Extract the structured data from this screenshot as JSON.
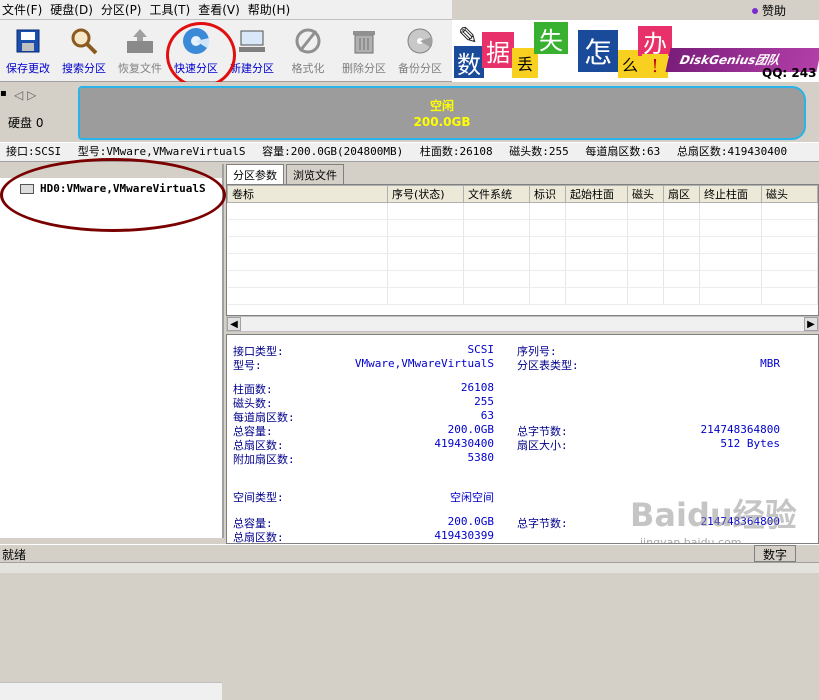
{
  "menu": [
    "文件(F)",
    "硬盘(D)",
    "分区(P)",
    "工具(T)",
    "查看(V)",
    "帮助(H)"
  ],
  "sponsor": "赞助",
  "toolbar": [
    {
      "label": "保存更改",
      "icon": "save-icon",
      "enabled": true
    },
    {
      "label": "搜索分区",
      "icon": "search-icon",
      "enabled": true
    },
    {
      "label": "恢复文件",
      "icon": "recover-icon",
      "enabled": false
    },
    {
      "label": "快速分区",
      "icon": "quick-partition-icon",
      "enabled": true
    },
    {
      "label": "新建分区",
      "icon": "new-partition-icon",
      "enabled": true
    },
    {
      "label": "格式化",
      "icon": "format-icon",
      "enabled": false
    },
    {
      "label": "删除分区",
      "icon": "delete-icon",
      "enabled": false
    },
    {
      "label": "备份分区",
      "icon": "backup-icon",
      "enabled": false
    }
  ],
  "banner": {
    "chars": [
      "数",
      "据",
      "丢",
      "失",
      "怎",
      "么",
      "办",
      "!"
    ],
    "brand": "DiskGenius团队",
    "qq": "QQ: 243"
  },
  "disk": {
    "label": "硬盘 0",
    "free_label": "空闲",
    "free_size": "200.0GB"
  },
  "info": {
    "interface": "接口:SCSI",
    "model": "型号:VMware,VMwareVirtualS",
    "capacity": "容量:200.0GB(204800MB)",
    "cylinders": "柱面数:26108",
    "heads": "磁头数:255",
    "sectors_per_track": "每道扇区数:63",
    "total_sectors": "总扇区数:419430400"
  },
  "tree": {
    "item": "HD0:VMware,VMwareVirtualS"
  },
  "tabs": [
    "分区参数",
    "浏览文件"
  ],
  "table": {
    "headers": [
      "卷标",
      "序号(状态)",
      "文件系统",
      "标识",
      "起始柱面",
      "磁头",
      "扇区",
      "终止柱面",
      "磁头"
    ]
  },
  "details": {
    "interface_type_label": "接口类型:",
    "interface_type": "SCSI",
    "model_label": "型号:",
    "model": "VMware,VMwareVirtualS",
    "serial_label": "序列号:",
    "pt_type_label": "分区表类型:",
    "pt_type": "MBR",
    "cylinders_label": "柱面数:",
    "cylinders": "26108",
    "heads_label": "磁头数:",
    "heads": "255",
    "spt_label": "每道扇区数:",
    "spt": "63",
    "capacity_label": "总容量:",
    "capacity": "200.0GB",
    "total_bytes_label": "总字节数:",
    "total_bytes": "214748364800",
    "total_sectors_label": "总扇区数:",
    "total_sectors": "419430400",
    "sector_size_label": "扇区大小:",
    "sector_size": "512 Bytes",
    "extra_sectors_label": "附加扇区数:",
    "extra_sectors": "5380",
    "space_type_label": "空间类型:",
    "space_type": "空闲空间",
    "free_capacity_label": "总容量:",
    "free_capacity": "200.0GB",
    "free_bytes_label": "总字节数:",
    "free_bytes": "214748364800",
    "free_sectors_label": "总扇区数:",
    "free_sectors": "419430399"
  },
  "status": {
    "text": "就绪",
    "num": "数字"
  },
  "watermark": {
    "brand": "Baidu经验",
    "url": "jingyan.baidu.com"
  }
}
